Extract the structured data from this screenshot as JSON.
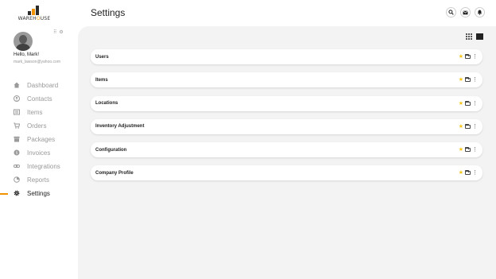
{
  "brand": {
    "name": "WAREHOUSE",
    "name_pre": "WAREH",
    "name_o": "O",
    "name_post": "USE",
    "accent": "#f39200"
  },
  "user": {
    "greeting": "Hello, Mark!",
    "email": "mark_lawson@yahoo.com"
  },
  "nav": [
    {
      "label": "Dashboard",
      "icon": "home-icon",
      "active": false
    },
    {
      "label": "Contacts",
      "icon": "person-icon",
      "active": false
    },
    {
      "label": "Items",
      "icon": "items-icon",
      "active": false
    },
    {
      "label": "Orders",
      "icon": "cart-icon",
      "active": false
    },
    {
      "label": "Packages",
      "icon": "package-icon",
      "active": false
    },
    {
      "label": "Invoices",
      "icon": "invoice-icon",
      "active": false
    },
    {
      "label": "Integrations",
      "icon": "link-icon",
      "active": false
    },
    {
      "label": "Reports",
      "icon": "report-icon",
      "active": false
    },
    {
      "label": "Settings",
      "icon": "gear-icon",
      "active": true
    }
  ],
  "header": {
    "title": "Settings"
  },
  "settings_rows": [
    {
      "label": "Users"
    },
    {
      "label": "Items"
    },
    {
      "label": "Locations"
    },
    {
      "label": "Inventory Adjustment"
    },
    {
      "label": "Configuration"
    },
    {
      "label": "Company Profile"
    }
  ]
}
